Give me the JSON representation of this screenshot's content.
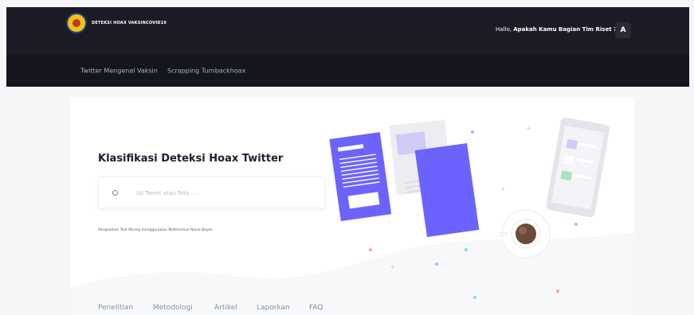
{
  "brand": {
    "name": "DETEKSI HOAX VAKSINCOVID19"
  },
  "header": {
    "greeting_prefix": "Hallo,",
    "greeting_bold": "Apakah Kamu Bagian Tim Riset ?",
    "avatar_letter": "A"
  },
  "nav": {
    "items": [
      "Twitter Mengenal Vaksin",
      "Scrapping Turnbackhoax"
    ]
  },
  "hero": {
    "title": "Klasifikasi Deteksi Hoax Twitter",
    "search_placeholder": "Uji Tweet atau Teks ....",
    "subtitle": "Pengolahan Text Mining menggunakan Multinomial Naive Bayes"
  },
  "footer_nav": [
    "Penelitian",
    "Metodologi",
    "Artikel",
    "Laporkan",
    "FAQ"
  ],
  "colors": {
    "topbar": "#1b1b25",
    "navbar": "#15151d",
    "accent": "#6c63ff",
    "background": "#f5f6f8"
  }
}
